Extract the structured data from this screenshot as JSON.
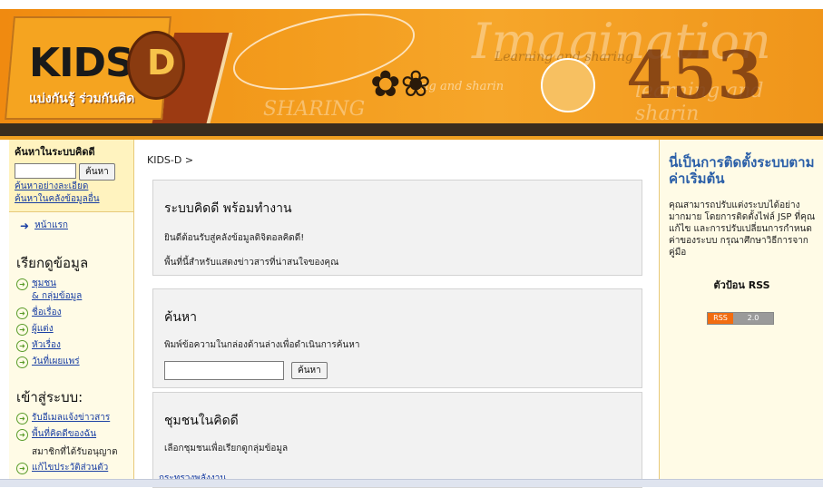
{
  "banner": {
    "logo_text": "KIDS",
    "logo_letter": "D",
    "tagline": "แบ่งกันรู้ ร่วมกันคิด",
    "deco_word": "Imagination",
    "deco_phrase1": "Learning and sharing",
    "deco_phrase2": "ing and sharin",
    "deco_phrase3": "learning and sharin",
    "deco_phrase4": "SHARING",
    "deco_numbers": "453"
  },
  "left": {
    "search_heading": "ค้นหาในระบบคิดดี",
    "search_input_value": "",
    "search_button": "ค้นหา",
    "advanced_search": "ค้นหาอย่างละเอียด",
    "other_search": "ค้นหาในคลังข้อมูลอื่น",
    "home_link": "หน้าแรก",
    "browse_heading": "เรียกดูข้อมูล",
    "browse_items": [
      "ชุมชน",
      "& กลุ่มข้อมูล",
      "ชื่อเรื่อง",
      "ผู้แต่ง",
      "หัวเรื่อง",
      "วันที่เผยแพร่"
    ],
    "login_heading": "เข้าสู่ระบบ:",
    "login_items": [
      "รับอีเมลแจ้งข่าวสาร",
      "พื้นที่คิดดีของฉัน",
      "สมาชิกที่ได้รับอนุญาต",
      "แก้ไขประวัติส่วนตัว"
    ]
  },
  "main": {
    "breadcrumb": "KIDS-D >",
    "panel1": {
      "title": "ระบบคิดดี พร้อมทำงาน",
      "line1": "ยินดีต้อนรับสู่คลังข้อมูลดิจิตอลคิดดี!",
      "line2": "พื้นที่นี้สำหรับแสดงข่าวสารที่น่าสนใจของคุณ"
    },
    "panel2": {
      "title": "ค้นหา",
      "instruction": "พิมพ์ข้อความในกล่องด้านล่างเพื่อดำเนินการค้นหา",
      "input_value": "",
      "button": "ค้นหา"
    },
    "panel3": {
      "title": "ชุมชนในคิดดี",
      "instruction": "เลือกชุมชนเพื่อเรียกดูกลุ่มข้อมูล",
      "community_link": "กระทรวงพลังงาน"
    }
  },
  "right": {
    "title": "นี่เป็นการติดตั้งระบบตามค่าเริ่มต้น",
    "body": "คุณสามารถปรับแต่งระบบได้อย่างมากมาย โดยการติดตั้งไฟล์ JSP ที่คุณแก้ไข และการปรับเปลี่ยนการกำหนดค่าของระบบ กรุณาศึกษาวิธีการจากคู่มือ",
    "rss_title": "ตัวป้อน RSS",
    "rss_badge_left": "RSS",
    "rss_badge_right": "2.0"
  },
  "colors": {
    "banner_orange": "#f39c1d",
    "link_blue": "#1a3fa3",
    "title_blue": "#2b5fa8",
    "rss_orange": "#f26c10"
  }
}
